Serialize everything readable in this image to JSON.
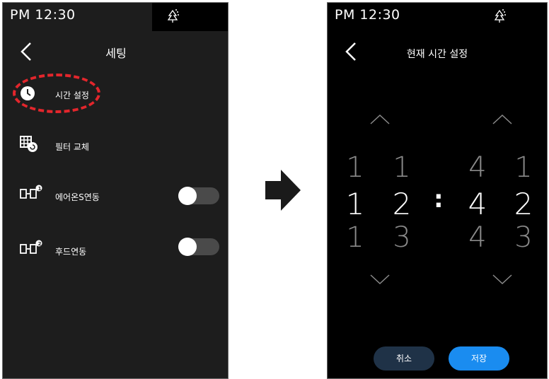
{
  "settings_screen": {
    "status_time": "PM 12:30",
    "title": "세팅",
    "items": [
      {
        "label": "시간 설정",
        "icon": "clock-icon"
      },
      {
        "label": "필터 교체",
        "icon": "filter-replace-icon"
      },
      {
        "label": "에어온S연동",
        "icon": "device-link-1-icon",
        "toggle": false,
        "badge": "1"
      },
      {
        "label": "후드연동",
        "icon": "device-link-2-icon",
        "toggle": false,
        "badge": "2"
      }
    ]
  },
  "time_screen": {
    "status_time": "PM 12:30",
    "title": "현재 시간 설정",
    "hour_tens": {
      "prev": "1",
      "current": "1",
      "next": "1"
    },
    "hour_ones": {
      "prev": "1",
      "current": "2",
      "next": "3"
    },
    "separator": ":",
    "minute_tens": {
      "prev": "4",
      "current": "4",
      "next": "4"
    },
    "minute_ones": {
      "prev": "1",
      "current": "2",
      "next": "3"
    },
    "cancel_label": "취소",
    "save_label": "저장"
  },
  "colors": {
    "highlight": "#e3262c",
    "save_button": "#1a8cf0",
    "cancel_button": "#1f3247"
  }
}
